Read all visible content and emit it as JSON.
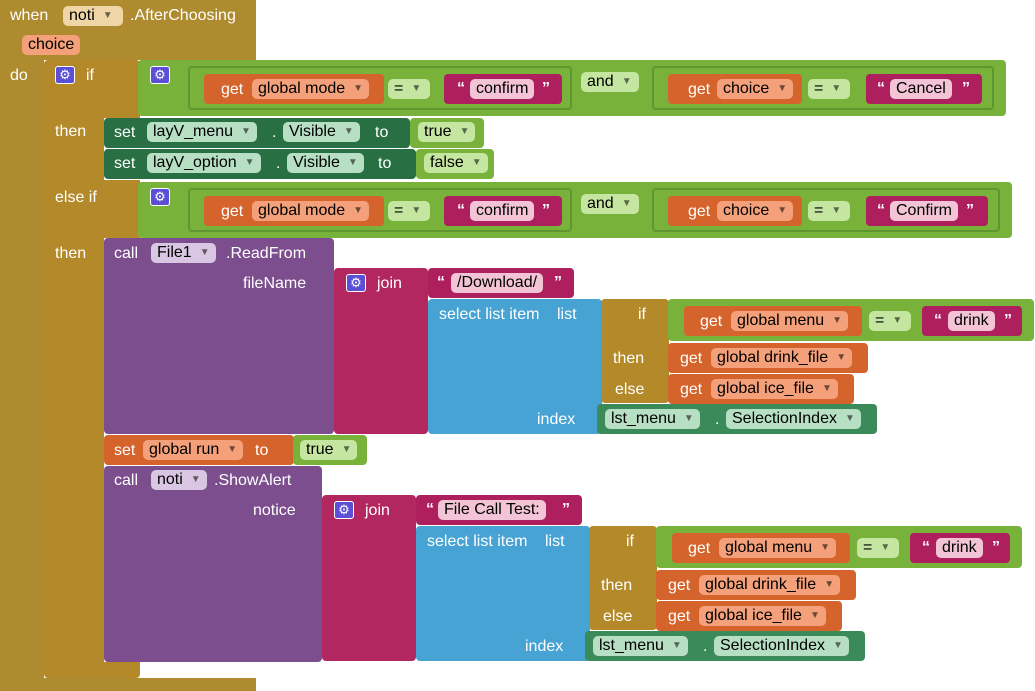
{
  "event": {
    "when": "when",
    "component": "noti",
    "name": ".AfterChoosing",
    "param": "choice",
    "do": "do"
  },
  "ctrl": {
    "if": "if",
    "then": "then",
    "else_if": "else if",
    "then2": "then"
  },
  "cond1": {
    "get": "get",
    "var_a": "global mode",
    "eq": "=",
    "str_a": "confirm",
    "and": "and",
    "var_b": "choice",
    "str_b": "Cancel"
  },
  "cond2": {
    "get": "get",
    "var_a": "global mode",
    "eq": "=",
    "str_a": "confirm",
    "and": "and",
    "var_b": "choice",
    "str_b": "Confirm"
  },
  "set1": {
    "set": "set",
    "comp": "layV_menu",
    "dot": ".",
    "prop": "Visible",
    "to": "to",
    "val": "true"
  },
  "set2": {
    "set": "set",
    "comp": "layV_option",
    "dot": ".",
    "prop": "Visible",
    "to": "to",
    "val": "false"
  },
  "call1": {
    "call": "call",
    "comp": "File1",
    "method": ".ReadFrom",
    "arg": "fileName",
    "join": "join",
    "str": "/Download/",
    "select": "select list item",
    "list": "list",
    "if": "if",
    "get": "get",
    "var": "global menu",
    "eq": "=",
    "cmp": "drink",
    "then": "then",
    "then_var": "global drink_file",
    "else": "else",
    "else_var": "global ice_file",
    "index": "index",
    "idx_comp": "lst_menu",
    "dot": ".",
    "idx_prop": "SelectionIndex"
  },
  "set3": {
    "set": "set",
    "var": "global run",
    "to": "to",
    "val": "true"
  },
  "call2": {
    "call": "call",
    "comp": "noti",
    "method": ".ShowAlert",
    "arg": "notice",
    "join": "join",
    "str": "File Call Test: ",
    "select": "select list item",
    "list": "list",
    "if": "if",
    "get": "get",
    "var": "global menu",
    "eq": "=",
    "cmp": "drink",
    "then": "then",
    "then_var": "global drink_file",
    "else": "else",
    "else_var": "global ice_file",
    "index": "index",
    "idx_comp": "lst_menu",
    "dot": ".",
    "idx_prop": "SelectionIndex"
  },
  "glyphs": {
    "gear": "⚙",
    "dropdown": "▼",
    "quote_l": "“",
    "quote_r": "”"
  },
  "colors": {
    "event": "#ad8b2e",
    "logic": "#78b23a",
    "variable": "#d4642c",
    "text": "#ae1f5d",
    "component_set": "#287043",
    "procedure_call": "#7c4e8e",
    "list": "#46a3d4",
    "join": "#b2275f"
  }
}
